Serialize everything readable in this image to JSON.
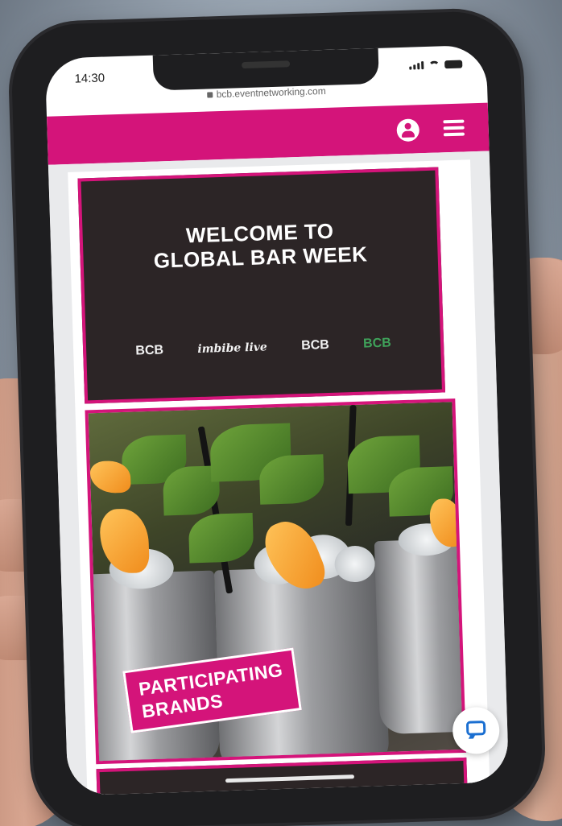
{
  "statusbar": {
    "time": "14:30",
    "icons": [
      "signal-icon",
      "wifi-icon",
      "battery-icon"
    ]
  },
  "browser": {
    "url": "bcb.eventnetworking.com"
  },
  "nav": {
    "icons": [
      "user-icon",
      "menu-icon"
    ],
    "color": "#d4147a"
  },
  "hero": {
    "title_line1": "WELCOME TO",
    "title_line2": "GLOBAL BAR WEEK",
    "logos": [
      "BCB",
      "imbibe live",
      "BCB",
      "BCB"
    ]
  },
  "promo": {
    "label_line1": "PARTICIPATING",
    "label_line2": "BRANDS"
  },
  "chat": {
    "icon": "chat-icon"
  }
}
